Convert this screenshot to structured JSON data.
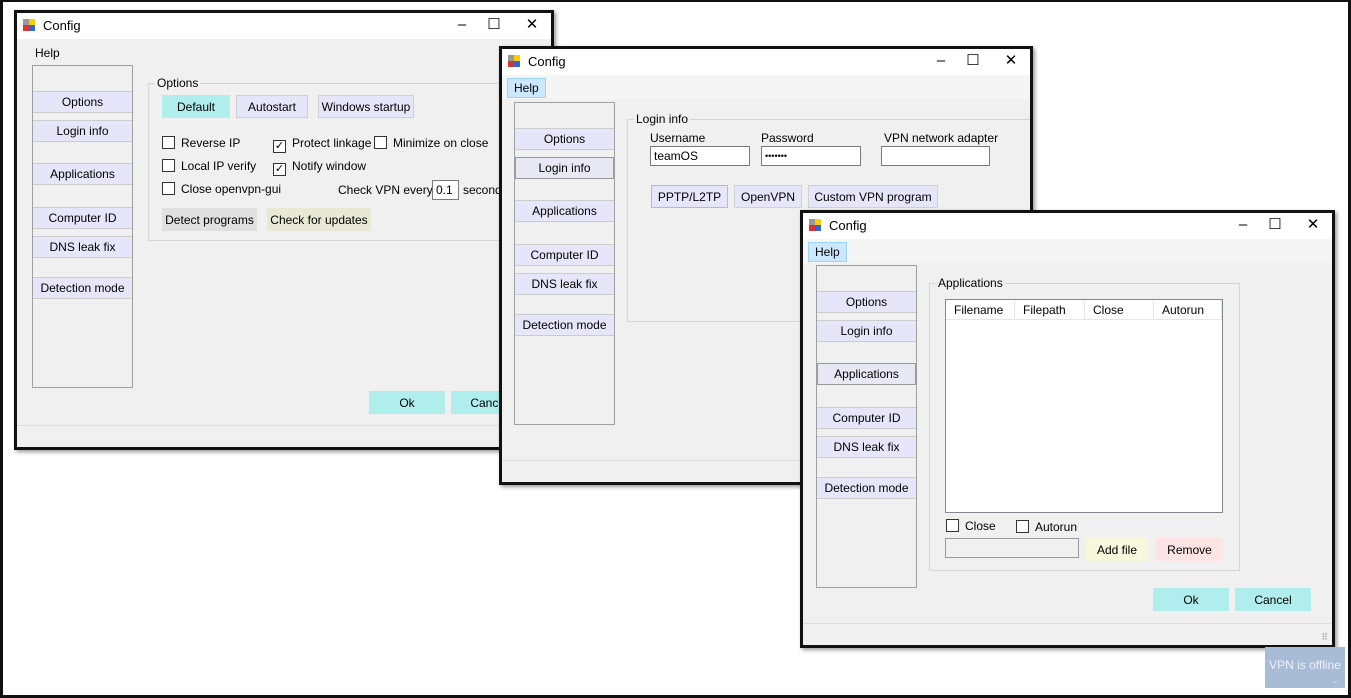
{
  "window_title": "Config",
  "menu_help": "Help",
  "sidebar": [
    "",
    "Options",
    "Login info",
    "",
    "Applications",
    "",
    "Computer ID",
    "DNS leak fix",
    "",
    "Detection mode"
  ],
  "options": {
    "group": "Options",
    "tabs": [
      "Default",
      "Autostart",
      "Windows startup"
    ],
    "checks": [
      {
        "label": "Reverse IP",
        "checked": false
      },
      {
        "label": "Protect linkage",
        "checked": true
      },
      {
        "label": "Minimize on close",
        "checked": false
      },
      {
        "label": "Local IP verify",
        "checked": false
      },
      {
        "label": "Notify window",
        "checked": true
      },
      {
        "label": "Close openvpn-gui",
        "checked": false
      }
    ],
    "check_vpn_label": "Check VPN every",
    "check_vpn_value": "0.1",
    "check_vpn_unit": "second",
    "detect": "Detect programs",
    "updates": "Check for updates"
  },
  "login": {
    "group": "Login info",
    "username_label": "Username",
    "username": "teamOS",
    "password_label": "Password",
    "password": "•••••••",
    "adapter_label": "VPN network adapter",
    "adapter": "",
    "buttons": [
      "PPTP/L2TP",
      "OpenVPN",
      "Custom VPN program"
    ]
  },
  "apps": {
    "group": "Applications",
    "columns": [
      "Filename",
      "Filepath",
      "Close",
      "Autorun"
    ],
    "close": "Close",
    "autorun": "Autorun",
    "file": "",
    "add": "Add file",
    "remove": "Remove"
  },
  "ok": "Ok",
  "cancel": "Cancel",
  "toast": "VPN is offline",
  "colors": {
    "accent_cyan": "#b0eeee",
    "tab_lavender": "#e6e6fa",
    "help_highlight": "#cce8ff"
  }
}
